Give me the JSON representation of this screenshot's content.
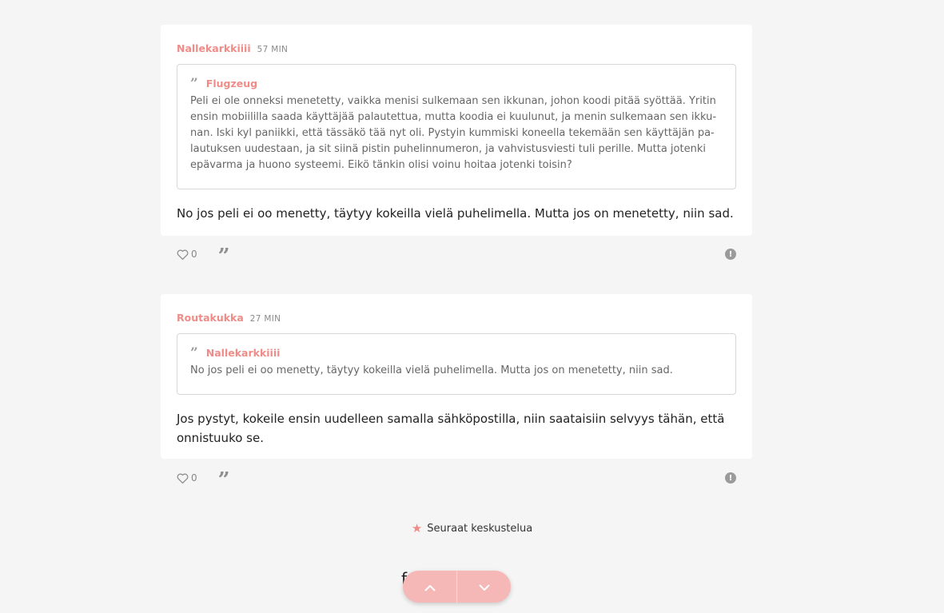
{
  "posts": [
    {
      "author": "Nallekarkkiiii",
      "time": "57 MIN",
      "quote": {
        "author": "Flugzeug",
        "lines": [
          "Peli ei ole onneksi menetetty, vaikka menisi sulkemaan sen ikkunan, johon koodi pitää syöttää. Yritin",
          "ensin mobiililla saada käyttäjää palautettua, mutta koodia ei kuulunut, ja menin sulkemaan sen ikku-",
          "nan. Iski kyl paniikki, että tässäkö tää nyt oli. Pystyin kummiski koneella tekemään sen käyttäjän pa-",
          "lautuksen uudestaan, ja sit siinä pistin puhelinnumeron, ja vahvistusviesti tuli perille. Mutta jotenki",
          "epävarma ja huono systeemi. Eikö tänkin olisi voinu hoitaa jotenki toisin?"
        ]
      },
      "body_lines": [
        "No jos peli ei oo menetty, täytyy kokeilla vielä puhelimella. Mutta jos on menetetty, niin sad."
      ],
      "likes": "0"
    },
    {
      "author": "Routakukka",
      "time": "27 MIN",
      "quote": {
        "author": "Nallekarkkiiii",
        "lines": [
          "No jos peli ei oo menetty, täytyy kokeilla vielä puhelimella. Mutta jos on menetetty, niin sad."
        ]
      },
      "body_lines": [
        "Jos pystyt, kokeile ensin uudelleen samalla sähköpostilla, niin saataisiin selvyys tähän, että",
        "onnistuuko se."
      ],
      "likes": "0"
    }
  ],
  "follow_label": "Seuraat keskustelua",
  "stray_char": "f",
  "icons": {
    "like": "heart-outline-icon",
    "quote": "quote-icon",
    "report": "exclamation-circle-icon",
    "follow": "star-icon",
    "nav_up": "chevron-up-icon",
    "nav_down": "chevron-down-icon"
  },
  "colors": {
    "accent": "#ef8c88",
    "nav_pill": "#f5b8b6",
    "background": "#f5f5f5",
    "card": "#ffffff"
  }
}
